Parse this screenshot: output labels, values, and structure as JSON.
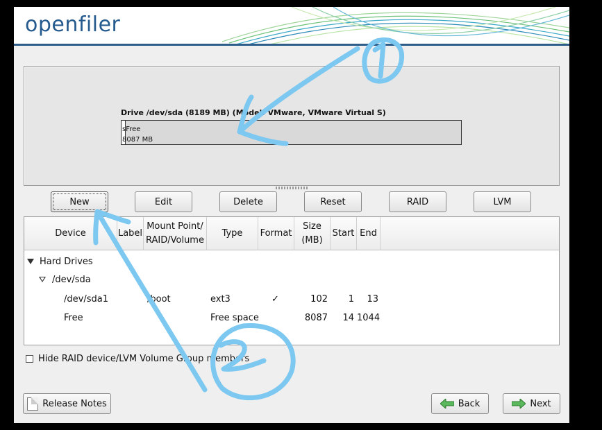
{
  "brand": {
    "logo": "openfiler"
  },
  "drive": {
    "title": "Drive /dev/sda (8189 MB) (Model: VMware, VMware Virtual S)",
    "segment_label": "Free",
    "segment_prefix": "s",
    "segment_size": "8087 MB"
  },
  "buttons": {
    "new": "New",
    "edit": "Edit",
    "delete": "Delete",
    "reset": "Reset",
    "raid": "RAID",
    "lvm": "LVM"
  },
  "table": {
    "columns": {
      "device": "Device",
      "label": "Label",
      "mount_1": "Mount Point/",
      "mount_2": "RAID/Volume",
      "type": "Type",
      "format": "Format",
      "size_1": "Size",
      "size_2": "(MB)",
      "start": "Start",
      "end": "End"
    },
    "group": "Hard Drives",
    "disk": "/dev/sda",
    "rows": [
      {
        "device": "/dev/sda1",
        "mount": "/boot",
        "type": "ext3",
        "format": "✓",
        "size": "102",
        "start": "1",
        "end": "13"
      },
      {
        "device": "Free",
        "mount": "",
        "type": "Free space",
        "format": "",
        "size": "8087",
        "start": "14",
        "end": "1044"
      }
    ]
  },
  "hide_option": "Hide RAID device/LVM Volume Group members",
  "footer": {
    "release_notes": "Release Notes",
    "back": "Back",
    "next": "Next"
  },
  "annotations": {
    "marker_1": "1",
    "marker_2": "2"
  },
  "colors": {
    "accent": "#245a8e",
    "annotation": "#7cc8f0"
  }
}
